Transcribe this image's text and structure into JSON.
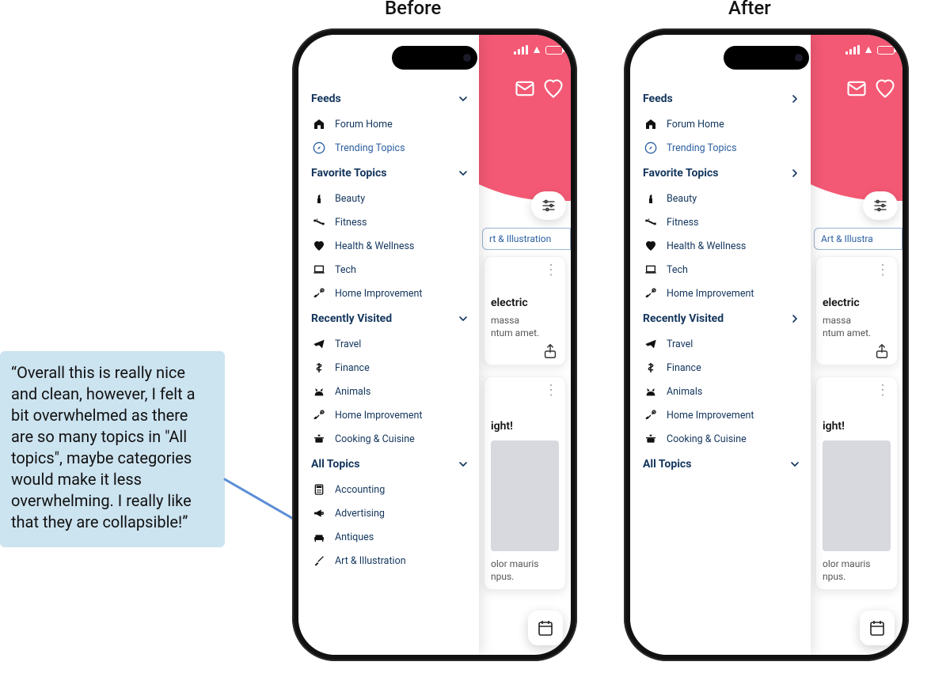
{
  "headings": {
    "before": "Before",
    "after": "After"
  },
  "quote": "“Overall this is really nice and clean, however, I felt a bit overwhelmed as there are so many topics in \"All topics\", maybe categories would make it less overwhelming. I really like that they are collapsible!”",
  "sidebar": {
    "feeds": {
      "title": "Feeds",
      "items": [
        {
          "icon": "home-icon",
          "label": "Forum Home",
          "link": false
        },
        {
          "icon": "compass-icon",
          "label": "Trending Topics",
          "link": true
        }
      ]
    },
    "favorites": {
      "title": "Favorite Topics",
      "items": [
        {
          "icon": "lipstick-icon",
          "label": "Beauty"
        },
        {
          "icon": "dumbbell-icon",
          "label": "Fitness"
        },
        {
          "icon": "heart-icon",
          "label": "Health & Wellness"
        },
        {
          "icon": "laptop-icon",
          "label": "Tech"
        },
        {
          "icon": "tools-icon",
          "label": "Home Improvement"
        }
      ]
    },
    "recent": {
      "title": "Recently Visited",
      "items": [
        {
          "icon": "plane-icon",
          "label": "Travel"
        },
        {
          "icon": "dollar-icon",
          "label": "Finance"
        },
        {
          "icon": "cat-icon",
          "label": "Animals"
        },
        {
          "icon": "tools-icon",
          "label": "Home Improvement"
        },
        {
          "icon": "pot-icon",
          "label": "Cooking & Cuisine"
        }
      ]
    },
    "all": {
      "title": "All Topics",
      "items": [
        {
          "icon": "calc-icon",
          "label": "Accounting"
        },
        {
          "icon": "megaphone-icon",
          "label": "Advertising"
        },
        {
          "icon": "sofa-icon",
          "label": "Antiques"
        },
        {
          "icon": "brush-icon",
          "label": "Art & Illustration"
        }
      ]
    }
  },
  "peek": {
    "chip_before": "rt & Illustration",
    "chip_after": "Art & Illustra",
    "card1": {
      "title_tail": "electric",
      "body_tail_a": "massa",
      "body_tail_b": "ntum amet."
    },
    "card2": {
      "title_tail": "ight!"
    },
    "card3": {
      "body_tail_a": "olor mauris",
      "body_tail_b": "npus."
    }
  }
}
